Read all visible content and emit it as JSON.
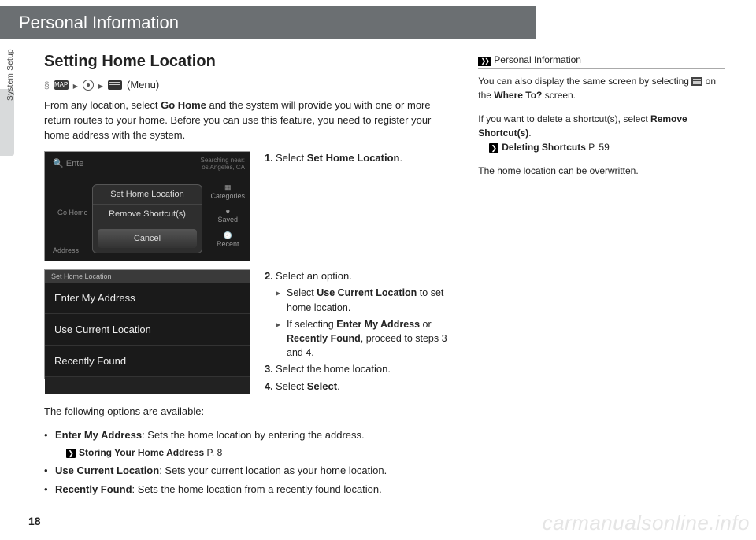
{
  "header": {
    "title": "Personal Information"
  },
  "sideTab": "System Setup",
  "pageNumber": "18",
  "watermark": "carmanualsonline.info",
  "section": {
    "title": "Setting Home Location",
    "breadcrumb": {
      "mapLabel": "MAP",
      "menuText": "(Menu)"
    },
    "intro": "From any location, select Go Home and the system will provide you with one or more return routes to your home. Before you can use this feature, you need to register your home address with the system."
  },
  "screenshot1": {
    "enter": "Ente",
    "searching": "Searching near:",
    "searchingLoc": "os Angeles, CA",
    "popup1": "Set Home Location",
    "popup2": "Remove Shortcut(s)",
    "cancel": "Cancel",
    "goHome": "Go Home",
    "addr": "Address",
    "rightCategories": "Categories",
    "rightSaved": "Saved",
    "rightRecent": "Recent"
  },
  "screenshot2": {
    "head": "Set Home Location",
    "item1": "Enter My Address",
    "item2": "Use Current Location",
    "item3": "Recently Found"
  },
  "steps": {
    "s1": "Select Set Home Location.",
    "s2": "Select an option.",
    "s2a": "Select Use Current Location to set home location.",
    "s2b": "If selecting Enter My Address or Recently Found, proceed to steps 3 and 4.",
    "s3": "Select the home location.",
    "s4": "Select Select."
  },
  "options": {
    "lead": "The following options are available:",
    "o1": "Enter My Address: Sets the home location by entering the address.",
    "o1ref": "Storing Your Home Address P. 8",
    "o2": "Use Current Location: Sets your current location as your home location.",
    "o3": "Recently Found: Sets the home location from a recently found location."
  },
  "notes": {
    "head": "Personal Information",
    "p1a": "You can also display the same screen by selecting",
    "p1b": "on the Where To? screen.",
    "p2": "If you want to delete a shortcut(s), select Remove Shortcut(s).",
    "p2ref": "Deleting Shortcuts P. 59",
    "p3": "The home location can be overwritten."
  }
}
